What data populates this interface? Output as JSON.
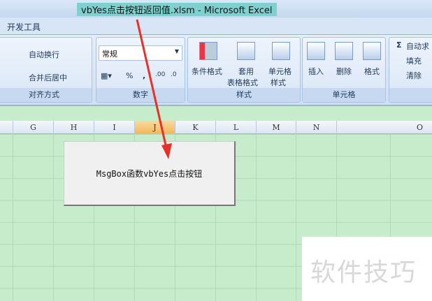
{
  "window": {
    "title": "vbYes点击按钮返回值.xlsm - Microsoft Excel"
  },
  "ribbon": {
    "tab": "开发工具",
    "alignment": {
      "wrap_text": "自动换行",
      "merge_center": "合并后居中",
      "label": "对齐方式"
    },
    "number": {
      "format": "常规",
      "percent": "%",
      "comma": ",",
      "inc_decimal": ".00",
      "dec_decimal": ".0",
      "label": "数字"
    },
    "styles": {
      "conditional": "条件格式",
      "table_format_1": "套用",
      "table_format_2": "表格格式",
      "cell_style_1": "单元格",
      "cell_style_2": "样式",
      "label": "样式"
    },
    "cells": {
      "insert": "插入",
      "delete": "删除",
      "format": "格式",
      "label": "单元格"
    },
    "editing": {
      "autosum": "自动求",
      "fill": "填充",
      "clear": "清除"
    }
  },
  "columns": [
    "G",
    "H",
    "I",
    "J",
    "K",
    "L",
    "M",
    "N",
    "O"
  ],
  "selected_column": "J",
  "sheet_button": {
    "label": "MsgBox函数vbYes点击按钮"
  },
  "watermark": "软件技巧",
  "colors": {
    "arrow": "#e8302a",
    "grid": "#c6eccb",
    "selected_header": "#f2b75a"
  }
}
